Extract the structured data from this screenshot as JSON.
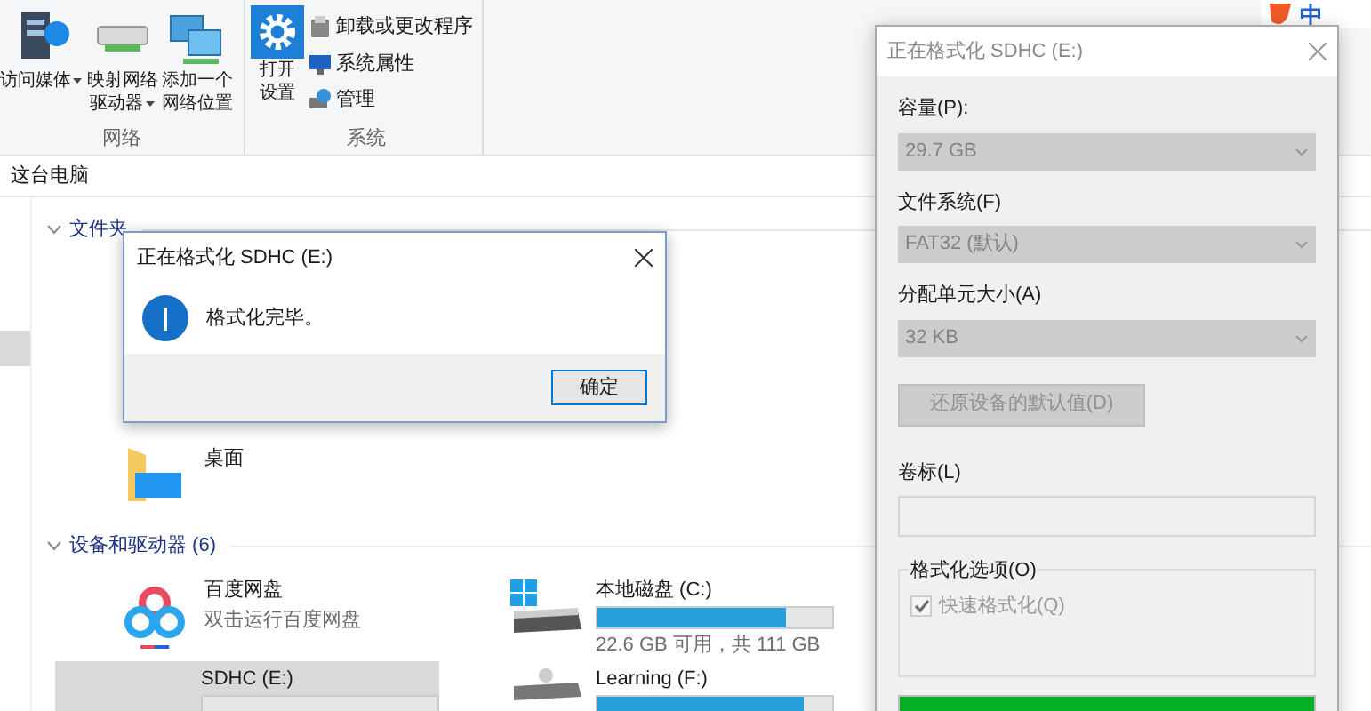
{
  "ime": {
    "label": "中"
  },
  "ribbon": {
    "groups": [
      {
        "label": "网络",
        "items": [
          {
            "kind": "media",
            "lines": [
              "访问媒体"
            ],
            "dropdown": true
          },
          {
            "kind": "drive-map",
            "lines": [
              "映射网络",
              "驱动器"
            ],
            "dropdown": true
          },
          {
            "kind": "network",
            "lines": [
              "添加一个",
              "网络位置"
            ],
            "dropdown": false
          }
        ]
      },
      {
        "label": "系统",
        "items": [
          {
            "kind": "settings",
            "lines": [
              "打开",
              "设置"
            ],
            "dropdown": false
          }
        ],
        "small_items": [
          {
            "kind": "uninstall",
            "label": "卸载或更改程序"
          },
          {
            "kind": "monitor",
            "label": "系统属性"
          },
          {
            "kind": "manage",
            "label": "管理"
          }
        ]
      }
    ]
  },
  "address": {
    "path": "这台电脑"
  },
  "nav": {
    "items": [
      {
        "selected": true
      }
    ]
  },
  "sections": [
    {
      "title": "文件夹",
      "expanded": true,
      "tiles": [
        {
          "kind": "desktop-folder",
          "name": "桌面",
          "selected": false
        }
      ]
    },
    {
      "title": "设备和驱动器 (6)",
      "expanded": true,
      "tiles": [
        {
          "kind": "baidu",
          "name": "百度网盘",
          "subtitle": "双击运行百度网盘",
          "selected": false
        },
        {
          "kind": "windows-drive",
          "name": "本地磁盘 (C:)",
          "level": 0.8,
          "detail": "22.6 GB 可用，共 111 GB",
          "selected": false
        },
        {
          "kind": "none",
          "name": "SDHC (E:)",
          "level": 0,
          "selected": true
        },
        {
          "kind": "drive",
          "name": "Learning (F:)",
          "level": 0.88,
          "selected": false
        }
      ]
    }
  ],
  "message_box": {
    "title": "正在格式化 SDHC (E:)",
    "message": "格式化完毕。",
    "button": "确定"
  },
  "format_dialog": {
    "title": "正在格式化 SDHC (E:)",
    "active": false,
    "fields": [
      {
        "label": "容量(P):",
        "value": "29.7 GB",
        "disabled": true
      },
      {
        "label": "文件系统(F)",
        "value": "FAT32 (默认)",
        "disabled": true
      },
      {
        "label": "分配单元大小(A)",
        "value": "32 KB",
        "disabled": true
      }
    ],
    "restore_button": {
      "label": "还原设备的默认值(D)",
      "disabled": true
    },
    "volume_label": {
      "label": "卷标(L)",
      "disabled": true
    },
    "options": {
      "title": "格式化选项(O)",
      "items": [
        {
          "label": "快速格式化(Q)",
          "checked": true,
          "disabled": true
        }
      ]
    },
    "progress": {
      "level": 1
    }
  }
}
